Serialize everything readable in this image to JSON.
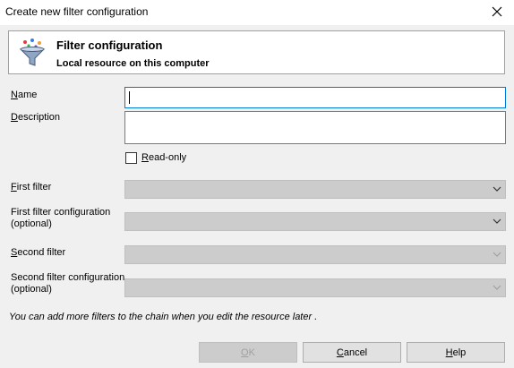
{
  "window": {
    "title": "Create new filter configuration"
  },
  "header": {
    "title": "Filter configuration",
    "subtitle": "Local resource on this computer"
  },
  "form": {
    "name": {
      "label_u": "N",
      "label_rest": "ame",
      "value": ""
    },
    "description": {
      "label_u": "D",
      "label_rest": "escription",
      "value": ""
    },
    "readonly": {
      "label_u": "R",
      "label_rest": "ead-only",
      "checked": false
    },
    "first_filter": {
      "label_u": "F",
      "label_rest": "irst filter",
      "value": "",
      "enabled": true
    },
    "first_filter_config": {
      "label_line1": "First filter configuration",
      "label_line2": "(optional)",
      "value": "",
      "enabled": true
    },
    "second_filter": {
      "label_u": "S",
      "label_rest": "econd filter",
      "value": "",
      "enabled": false
    },
    "second_filter_config": {
      "label_line1": "Second filter configuration",
      "label_line2": "(optional)",
      "value": "",
      "enabled": false
    }
  },
  "note": "You can add more filters to the chain when you edit the resource later .",
  "buttons": {
    "ok": {
      "label_u": "O",
      "label_rest": "K",
      "enabled": false
    },
    "cancel": {
      "label_u": "C",
      "label_rest": "ancel",
      "enabled": true
    },
    "help": {
      "label_u": "H",
      "label_rest": "elp",
      "enabled": true
    }
  },
  "icons": {
    "header": "funnel-filter-icon",
    "close": "close-icon",
    "dropdown": "chevron-down-icon"
  },
  "colors": {
    "focus_border": "#0078d7",
    "disabled_field": "#cccccc",
    "window_bg": "#f0f0f0"
  }
}
